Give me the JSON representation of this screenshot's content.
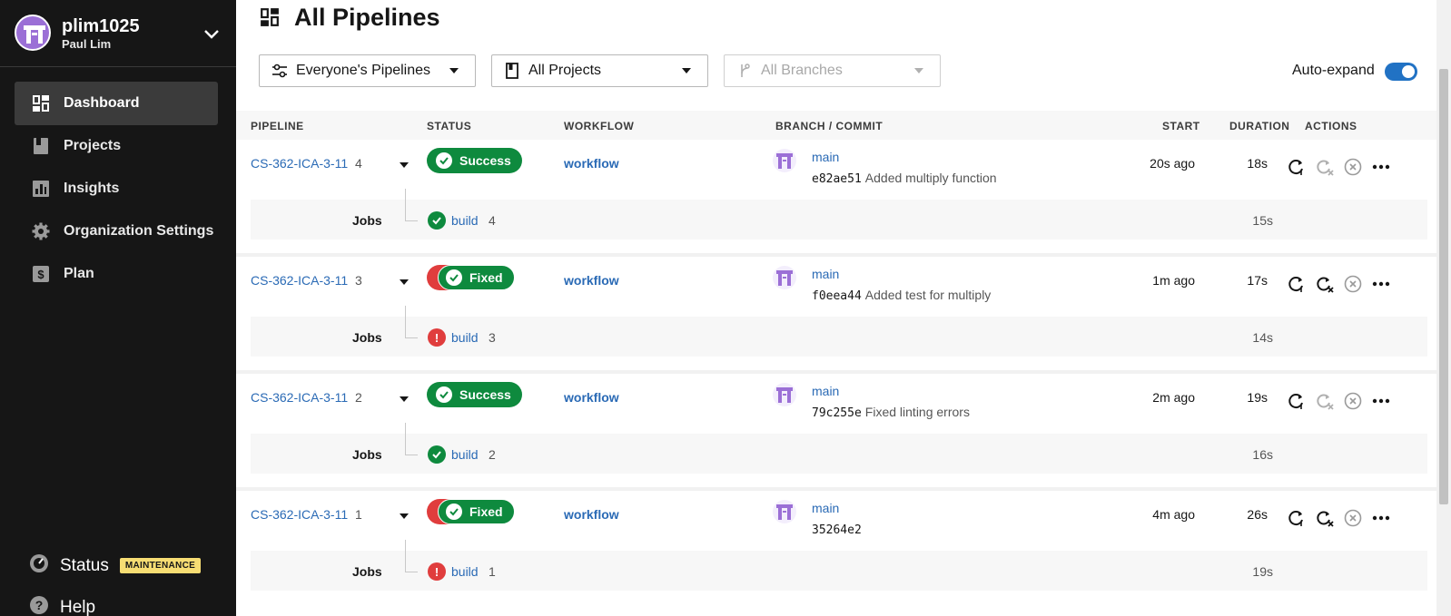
{
  "sidebar": {
    "org_name": "plim1025",
    "user_name": "Paul Lim",
    "nav": [
      {
        "label": "Dashboard",
        "icon": "dashboard-icon",
        "active": true
      },
      {
        "label": "Projects",
        "icon": "projects-icon"
      },
      {
        "label": "Insights",
        "icon": "insights-icon"
      },
      {
        "label": "Organization Settings",
        "icon": "gear-icon"
      },
      {
        "label": "Plan",
        "icon": "plan-icon"
      }
    ],
    "status_label": "Status",
    "maintenance_badge": "MAINTENANCE",
    "help_label": "Help"
  },
  "header": {
    "title": "All Pipelines",
    "filters": {
      "pipelines": "Everyone's Pipelines",
      "projects": "All Projects",
      "branches": "All Branches"
    },
    "auto_expand_label": "Auto-expand",
    "auto_expand_on": true
  },
  "table": {
    "columns": [
      "PIPELINE",
      "STATUS",
      "WORKFLOW",
      "BRANCH / COMMIT",
      "START",
      "DURATION",
      "ACTIONS"
    ],
    "jobs_label": "Jobs",
    "rows": [
      {
        "pipeline": "CS-362-ICA-3-11",
        "number": "4",
        "status": "Success",
        "workflow": "workflow",
        "branch": "main",
        "sha": "e82ae51",
        "message": "Added multiply function",
        "start": "20s ago",
        "duration": "18s",
        "job_name": "build",
        "job_number": "4",
        "job_status": "success",
        "job_duration": "15s"
      },
      {
        "pipeline": "CS-362-ICA-3-11",
        "number": "3",
        "status": "Fixed",
        "workflow": "workflow",
        "branch": "main",
        "sha": "f0eea44",
        "message": "Added test for multiply",
        "start": "1m ago",
        "duration": "17s",
        "job_name": "build",
        "job_number": "3",
        "job_status": "failed",
        "job_duration": "14s"
      },
      {
        "pipeline": "CS-362-ICA-3-11",
        "number": "2",
        "status": "Success",
        "workflow": "workflow",
        "branch": "main",
        "sha": "79c255e",
        "message": "Fixed linting errors",
        "start": "2m ago",
        "duration": "19s",
        "job_name": "build",
        "job_number": "2",
        "job_status": "success",
        "job_duration": "16s"
      },
      {
        "pipeline": "CS-362-ICA-3-11",
        "number": "1",
        "status": "Fixed",
        "workflow": "workflow",
        "branch": "main",
        "sha": "35264e2",
        "message": "",
        "start": "4m ago",
        "duration": "26s",
        "job_name": "build",
        "job_number": "1",
        "job_status": "failed",
        "job_duration": "19s"
      }
    ]
  },
  "colors": {
    "success": "#0e8a3e",
    "failed": "#e03d3d",
    "link": "#2a6ab5",
    "sidebar_bg": "#161616",
    "toggle": "#2172c4",
    "maintenance": "#f7dd73"
  }
}
